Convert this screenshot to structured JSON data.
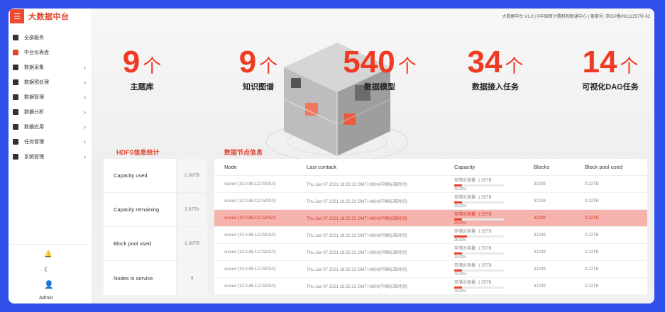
{
  "app": {
    "logo_text": "大数据中台",
    "menu_icon": "hamburger-icon"
  },
  "top_bar": {
    "info": "大数据中台 V1.0 | ©中国审计署机构联通中心 | 备案号: 京ICP备09112257号-62"
  },
  "sidebar": {
    "items": [
      {
        "label": "全部服务",
        "icon": "grid-icon",
        "has_children": false,
        "active": false
      },
      {
        "label": "中台仪表盘",
        "icon": "dashboard-icon",
        "has_children": false,
        "active": true
      },
      {
        "label": "数据采集",
        "icon": "collect-icon",
        "has_children": true,
        "active": false
      },
      {
        "label": "数据预处理",
        "icon": "preprocess-icon",
        "has_children": true,
        "active": false
      },
      {
        "label": "数据管理",
        "icon": "manage-icon",
        "has_children": true,
        "active": false
      },
      {
        "label": "数据分析",
        "icon": "analysis-icon",
        "has_children": true,
        "active": false
      },
      {
        "label": "数据应用",
        "icon": "apply-icon",
        "has_children": true,
        "active": false
      },
      {
        "label": "任务管理",
        "icon": "task-icon",
        "has_children": true,
        "active": false
      },
      {
        "label": "系统管理",
        "icon": "system-icon",
        "has_children": true,
        "active": false
      }
    ],
    "chevron": "›",
    "bottom": {
      "user": "Admin"
    }
  },
  "stats": [
    {
      "value": "9",
      "unit": "个",
      "label": "主题库"
    },
    {
      "value": "9",
      "unit": "个",
      "label": "知识图谱"
    },
    {
      "value": "540",
      "unit": "个",
      "label": "数据模型"
    },
    {
      "value": "34",
      "unit": "个",
      "label": "数据接入任务"
    },
    {
      "value": "14",
      "unit": "个",
      "label": "可视化DAG任务"
    }
  ],
  "hdfs": {
    "title": "HDFS信息统计",
    "rows": [
      {
        "label": "Capacity used",
        "value": "1.30TB"
      },
      {
        "label": "Capacity remaining",
        "value": "5.97Tb"
      },
      {
        "label": "Block pool used",
        "value": "2.30TB"
      },
      {
        "label": "Nodes in service",
        "value": "9"
      }
    ]
  },
  "nodes": {
    "title": "数据节点信息",
    "columns": [
      "Node",
      "Last contack",
      "Capacity",
      "Blocks",
      "Block pool used"
    ],
    "rows": [
      {
        "node": "slave4 (10.0.88.112:50010)",
        "last": "Thu Jan 07 2021 18:25:23 GMT+0800(中国标准时间)",
        "cap": "存储总容量: 1.55TB",
        "pct": "15.52%",
        "fill": 0.16,
        "blocks": "32239",
        "pool": "0.22TB",
        "hl": false
      },
      {
        "node": "slave4 (10.0.88.112:50010)",
        "last": "Thu Jan 07 2021 18:25:23 GMT+0800(中国标准时间)",
        "cap": "存储总容量: 1.55TB",
        "pct": "15.52%",
        "fill": 0.16,
        "blocks": "32239",
        "pool": "0.22TB",
        "hl": false
      },
      {
        "node": "slave4 (10.0.88.112:50010)",
        "last": "Thu Jan 07 2021 18:25:23 GMT+0800(中国标准时间)",
        "cap": "存储总容量: 1.55TB",
        "pct": "15.52%",
        "fill": 0.16,
        "blocks": "32239",
        "pool": "0.22TB",
        "hl": true
      },
      {
        "node": "slave4 (10.0.88.112:50010)",
        "last": "Thu Jan 07 2021 18:25:23 GMT+0800(中国标准时间)",
        "cap": "存储总容量: 1.55TB",
        "pct": "25.52%",
        "fill": 0.26,
        "blocks": "32239",
        "pool": "0.22TB",
        "hl": false
      },
      {
        "node": "slave4 (10.0.88.112:50010)",
        "last": "Thu Jan 07 2021 18:25:23 GMT+0800(中国标准时间)",
        "cap": "存储总容量: 1.55TB",
        "pct": "15.52%",
        "fill": 0.16,
        "blocks": "32239",
        "pool": "0.22TB",
        "hl": false
      },
      {
        "node": "slave4 (10.0.88.112:50010)",
        "last": "Thu Jan 07 2021 18:25:23 GMT+0800(中国标准时间)",
        "cap": "存储总容量: 1.55TB",
        "pct": "15.52%",
        "fill": 0.16,
        "blocks": "32239",
        "pool": "0.22TB",
        "hl": false
      },
      {
        "node": "slave4 (10.0.88.112:50010)",
        "last": "Thu Jan 07 2021 18:25:23 GMT+0800(中国标准时间)",
        "cap": "存储总容量: 1.55TB",
        "pct": "15.52%",
        "fill": 0.16,
        "blocks": "32239",
        "pool": "0.22TB",
        "hl": false
      }
    ]
  },
  "colors": {
    "accent": "#e6412b",
    "frame": "#2e50e8",
    "highlight_row": "#f6b3ad"
  }
}
